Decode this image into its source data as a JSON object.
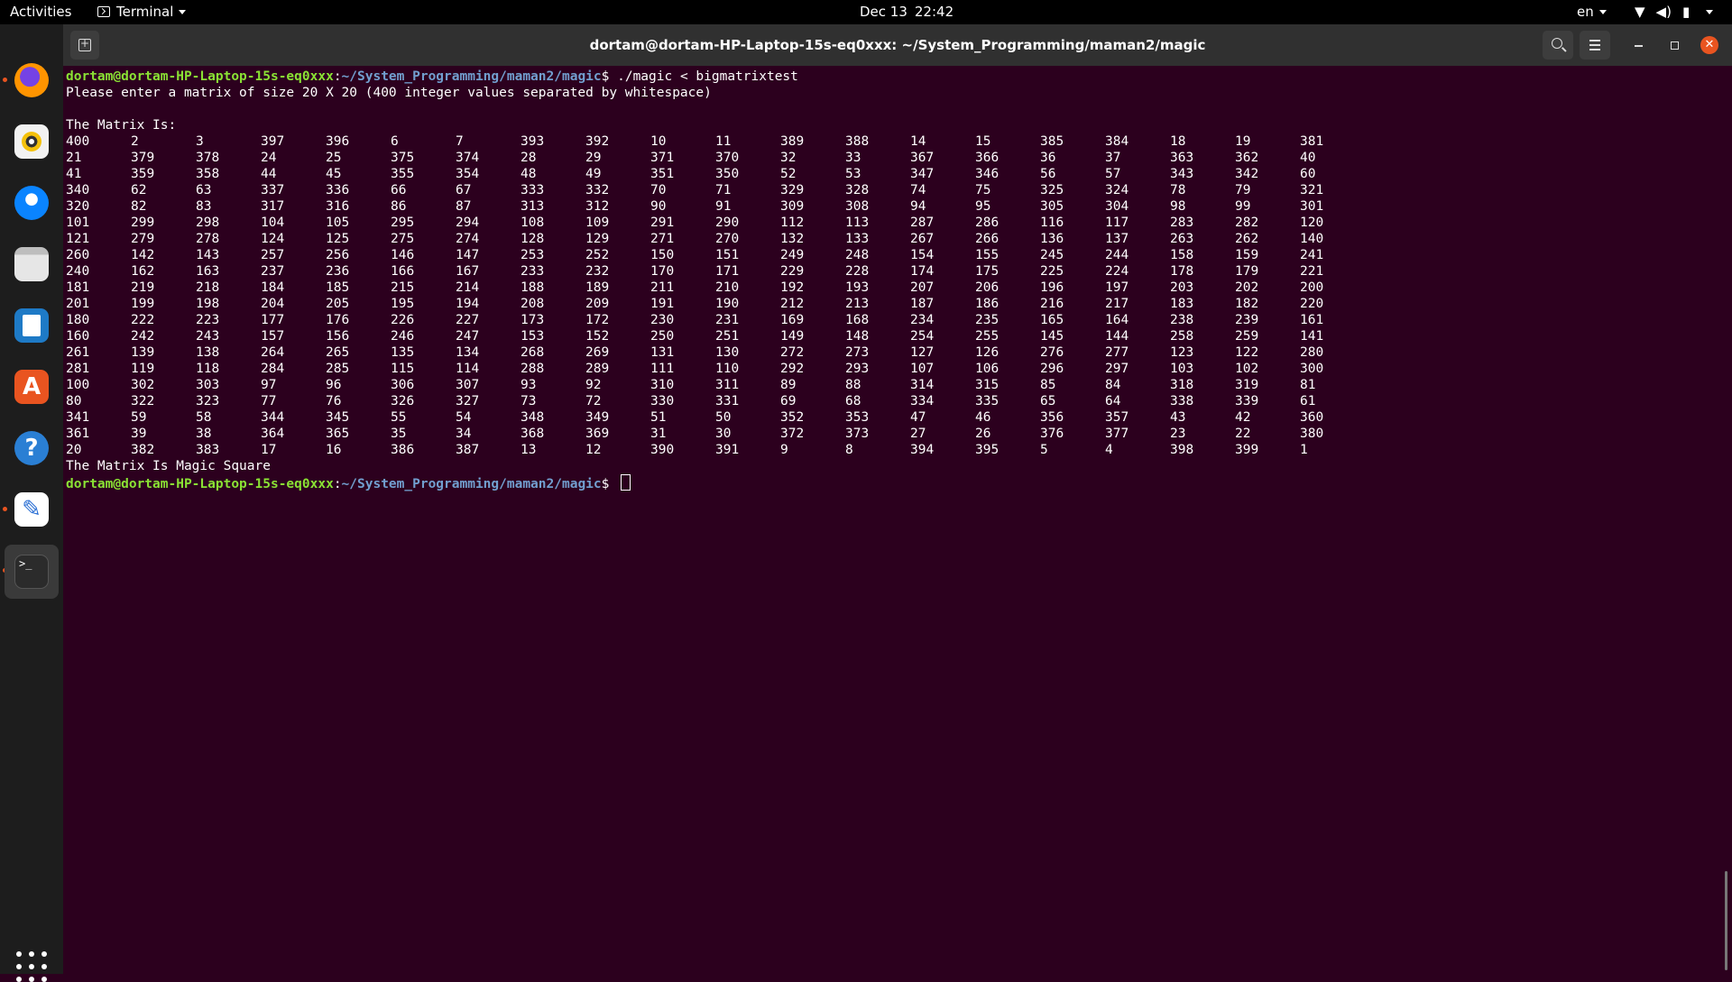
{
  "topbar": {
    "activities": "Activities",
    "app_menu": "Terminal",
    "date": "Dec 13",
    "time": "22:42",
    "language": "en"
  },
  "dock": {
    "items": [
      "firefox-icon",
      "rhythmbox-icon",
      "thunderbird-icon",
      "files-icon",
      "libreoffice-writer-icon",
      "ubuntu-software-icon",
      "help-icon",
      "text-editor-icon",
      "terminal-icon",
      "show-applications-icon"
    ]
  },
  "window": {
    "title": "dortam@dortam-HP-Laptop-15s-eq0xxx: ~/System_Programming/maman2/magic"
  },
  "terminal": {
    "prompt_user": "dortam@dortam-HP-Laptop-15s-eq0xxx",
    "prompt_path": "~/System_Programming/maman2/magic",
    "prompt_sep": ":",
    "prompt_end": "$ ",
    "command": "./magic < bigmatrixtest",
    "line_request": "Please enter a matrix of size 20 X 20 (400 integer values separated by whitespace)",
    "matrix_header": "The Matrix Is:",
    "result": "The Matrix Is Magic Square",
    "matrix": [
      [
        400,
        2,
        3,
        397,
        396,
        6,
        7,
        393,
        392,
        10,
        11,
        389,
        388,
        14,
        15,
        385,
        384,
        18,
        19,
        381
      ],
      [
        21,
        379,
        378,
        24,
        25,
        375,
        374,
        28,
        29,
        371,
        370,
        32,
        33,
        367,
        366,
        36,
        37,
        363,
        362,
        40
      ],
      [
        41,
        359,
        358,
        44,
        45,
        355,
        354,
        48,
        49,
        351,
        350,
        52,
        53,
        347,
        346,
        56,
        57,
        343,
        342,
        60
      ],
      [
        340,
        62,
        63,
        337,
        336,
        66,
        67,
        333,
        332,
        70,
        71,
        329,
        328,
        74,
        75,
        325,
        324,
        78,
        79,
        321
      ],
      [
        320,
        82,
        83,
        317,
        316,
        86,
        87,
        313,
        312,
        90,
        91,
        309,
        308,
        94,
        95,
        305,
        304,
        98,
        99,
        301
      ],
      [
        101,
        299,
        298,
        104,
        105,
        295,
        294,
        108,
        109,
        291,
        290,
        112,
        113,
        287,
        286,
        116,
        117,
        283,
        282,
        120
      ],
      [
        121,
        279,
        278,
        124,
        125,
        275,
        274,
        128,
        129,
        271,
        270,
        132,
        133,
        267,
        266,
        136,
        137,
        263,
        262,
        140
      ],
      [
        260,
        142,
        143,
        257,
        256,
        146,
        147,
        253,
        252,
        150,
        151,
        249,
        248,
        154,
        155,
        245,
        244,
        158,
        159,
        241
      ],
      [
        240,
        162,
        163,
        237,
        236,
        166,
        167,
        233,
        232,
        170,
        171,
        229,
        228,
        174,
        175,
        225,
        224,
        178,
        179,
        221
      ],
      [
        181,
        219,
        218,
        184,
        185,
        215,
        214,
        188,
        189,
        211,
        210,
        192,
        193,
        207,
        206,
        196,
        197,
        203,
        202,
        200
      ],
      [
        201,
        199,
        198,
        204,
        205,
        195,
        194,
        208,
        209,
        191,
        190,
        212,
        213,
        187,
        186,
        216,
        217,
        183,
        182,
        220
      ],
      [
        180,
        222,
        223,
        177,
        176,
        226,
        227,
        173,
        172,
        230,
        231,
        169,
        168,
        234,
        235,
        165,
        164,
        238,
        239,
        161
      ],
      [
        160,
        242,
        243,
        157,
        156,
        246,
        247,
        153,
        152,
        250,
        251,
        149,
        148,
        254,
        255,
        145,
        144,
        258,
        259,
        141
      ],
      [
        261,
        139,
        138,
        264,
        265,
        135,
        134,
        268,
        269,
        131,
        130,
        272,
        273,
        127,
        126,
        276,
        277,
        123,
        122,
        280
      ],
      [
        281,
        119,
        118,
        284,
        285,
        115,
        114,
        288,
        289,
        111,
        110,
        292,
        293,
        107,
        106,
        296,
        297,
        103,
        102,
        300
      ],
      [
        100,
        302,
        303,
        97,
        96,
        306,
        307,
        93,
        92,
        310,
        311,
        89,
        88,
        314,
        315,
        85,
        84,
        318,
        319,
        81
      ],
      [
        80,
        322,
        323,
        77,
        76,
        326,
        327,
        73,
        72,
        330,
        331,
        69,
        68,
        334,
        335,
        65,
        64,
        338,
        339,
        61
      ],
      [
        341,
        59,
        58,
        344,
        345,
        55,
        54,
        348,
        349,
        51,
        50,
        352,
        353,
        47,
        46,
        356,
        357,
        43,
        42,
        360
      ],
      [
        361,
        39,
        38,
        364,
        365,
        35,
        34,
        368,
        369,
        31,
        30,
        372,
        373,
        27,
        26,
        376,
        377,
        23,
        22,
        380
      ],
      [
        20,
        382,
        383,
        17,
        16,
        386,
        387,
        13,
        12,
        390,
        391,
        9,
        8,
        394,
        395,
        5,
        4,
        398,
        399,
        1
      ]
    ]
  },
  "colors": {
    "terminal_bg": "#2c001e",
    "prompt_user": "#8ae234",
    "prompt_path": "#729fcf",
    "accent": "#e95420"
  }
}
